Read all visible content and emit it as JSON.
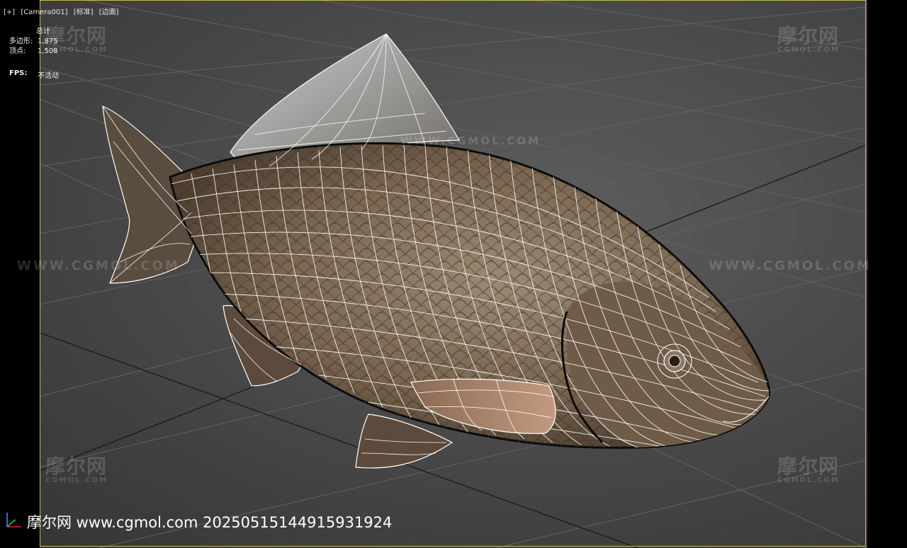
{
  "viewport": {
    "label_plus": "[+]",
    "label_camera": "[Camera001]",
    "label_mode": "[标准]",
    "label_shading": "[边面]"
  },
  "stats": {
    "title": "总计",
    "polygons_label": "多边形:",
    "polygons_value": "1,875",
    "vertices_label": "顶点:",
    "vertices_value": "1,508",
    "fps_label": "FPS:",
    "fps_value": "不活动"
  },
  "watermark": {
    "logo_text": "摩尔网",
    "logo_sub": "CGMOL.COM",
    "url_text": "WWW.CGMOL.COM"
  },
  "footer": {
    "text": "摩尔网 www.cgmol.com 20250515144915931924"
  },
  "colors": {
    "frame": "#c8b94a",
    "grid": "#5f5f5f",
    "fish_body": "#7d6a55",
    "wire": "#ffffff"
  }
}
